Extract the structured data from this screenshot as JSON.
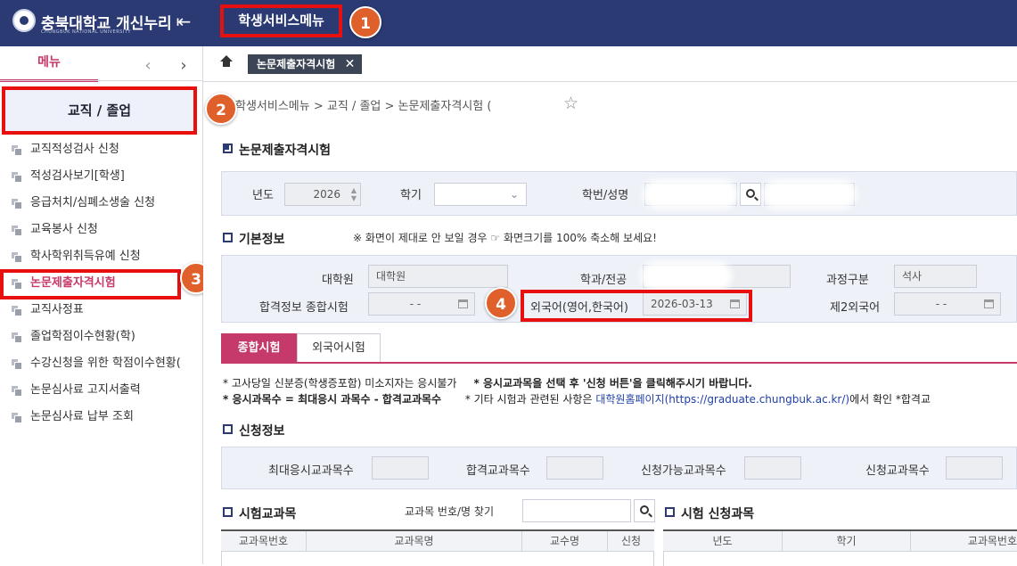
{
  "app": {
    "logo_text": "충북대학교 개신누리",
    "logo_sub": "CHUNGBUK NATIONAL UNIVERSITY",
    "top_menu": "학생서비스메뉴"
  },
  "badges": [
    "1",
    "2",
    "3",
    "4"
  ],
  "sidebar": {
    "tab": "메뉴",
    "category": "교직 / 졸업",
    "items": [
      {
        "label": "교직적성검사 신청"
      },
      {
        "label": "적성검사보기[학생]"
      },
      {
        "label": "응급처치/심폐소생술 신청"
      },
      {
        "label": "교육봉사 신청"
      },
      {
        "label": "학사학위취득유예 신청"
      },
      {
        "label": "논문제출자격시험"
      },
      {
        "label": "교직사정표"
      },
      {
        "label": "졸업학점이수현황(학)"
      },
      {
        "label": "수강신청을 위한 학점이수현황("
      },
      {
        "label": "논문심사료 고지서출력"
      },
      {
        "label": "논문심사료 납부 조회"
      }
    ]
  },
  "tabbar": {
    "open_tab": "논문제출자격시험"
  },
  "breadcrumb": "학생서비스메뉴 > 교직 / 졸업 > 논문제출자격시험 (",
  "page_title": "논문제출자격시험",
  "search_panel": {
    "year_label": "년도",
    "year_value": "2026",
    "semester_label": "학기",
    "student_label": "학번/성명"
  },
  "basic_info": {
    "title": "기본정보",
    "notice": "※ 화면이 제대로 안 보일 경우 ☞ 화면크기를 100% 축소해 보세요!",
    "grad_school_label": "대학원",
    "grad_school_value": "대학원",
    "dept_label": "학과/전공",
    "course_label": "과정구분",
    "course_value": "석사",
    "pass_comp_label": "합격정보 종합시험",
    "pass_comp_value": "-   -",
    "foreign_label": "외국어(영어,한국어)",
    "foreign_value": "2026-03-13",
    "second_foreign_label": "제2외국어",
    "second_foreign_value": "-   -"
  },
  "exam_tabs": [
    "종합시험",
    "외국어시험"
  ],
  "notes": {
    "line1_a": "* 고사당일 신분증(학생증포함) 미소지자는 응시불가",
    "line1_b": "* 응시교과목을 선택 후 '신청 버튼'을 클릭해주시기 바랍니다.",
    "line2_a": "* 응시과목수 = 최대응시 과목수 - 합격교과목수",
    "line2_b": "* 기타 시험과 관련된 사항은",
    "line2_link": "대학원홈페이지(https://graduate.chungbuk.ac.kr/)",
    "line2_c": "에서 확인  *합격교"
  },
  "apply_info": {
    "title": "신청정보",
    "max_label": "최대응시교과목수",
    "passed_label": "합격교과목수",
    "available_label": "신청가능교과목수",
    "applied_label": "신청교과목수"
  },
  "exam_subjects": {
    "title": "시험교과목",
    "search_label": "교과목 번호/명 찾기",
    "columns": [
      "교과목번호",
      "교과목명",
      "교수명",
      "신청"
    ]
  },
  "applied_subjects": {
    "title": "시험 신청과목",
    "columns": [
      "년도",
      "학기",
      "교과목번호"
    ]
  }
}
